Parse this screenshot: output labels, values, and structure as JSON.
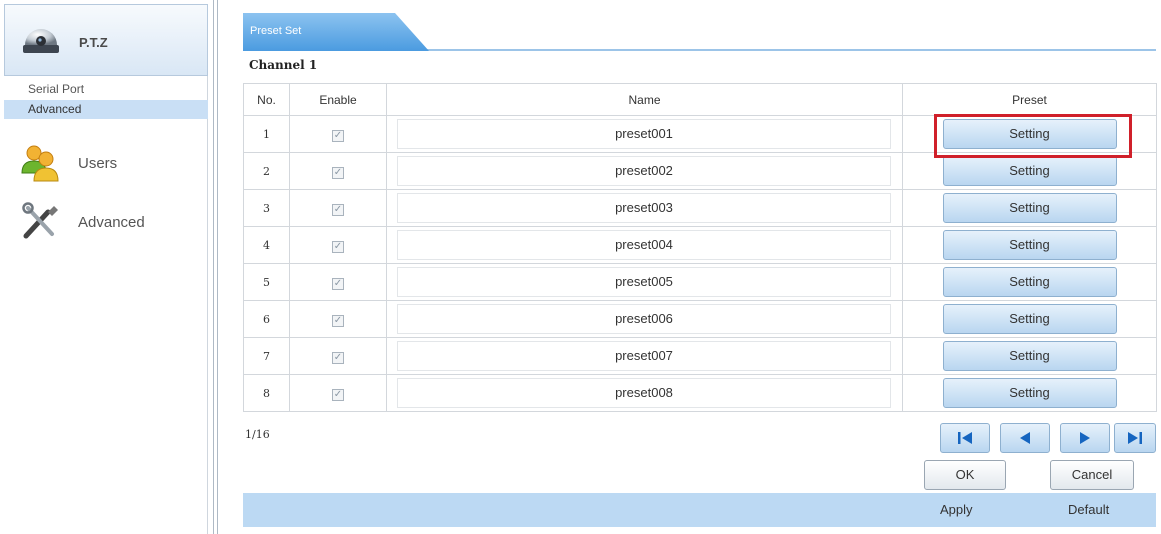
{
  "sidebar": {
    "header_label": "P.T.Z",
    "sub_items": [
      {
        "label": "Serial Port"
      },
      {
        "label": "Advanced",
        "selected": true
      }
    ],
    "menu": [
      {
        "label": "Users",
        "icon": "users-icon"
      },
      {
        "label": "Advanced",
        "icon": "tools-icon"
      }
    ]
  },
  "tab": {
    "label": "Preset Set"
  },
  "channel_title": "Channel 1",
  "table": {
    "headers": {
      "no": "No.",
      "enable": "Enable",
      "name": "Name",
      "preset": "Preset"
    },
    "rows": [
      {
        "no": "1",
        "enabled": true,
        "name": "preset001",
        "button": "Setting",
        "highlighted": true
      },
      {
        "no": "2",
        "enabled": true,
        "name": "preset002",
        "button": "Setting"
      },
      {
        "no": "3",
        "enabled": true,
        "name": "preset003",
        "button": "Setting"
      },
      {
        "no": "4",
        "enabled": true,
        "name": "preset004",
        "button": "Setting"
      },
      {
        "no": "5",
        "enabled": true,
        "name": "preset005",
        "button": "Setting"
      },
      {
        "no": "6",
        "enabled": true,
        "name": "preset006",
        "button": "Setting"
      },
      {
        "no": "7",
        "enabled": true,
        "name": "preset007",
        "button": "Setting"
      },
      {
        "no": "8",
        "enabled": true,
        "name": "preset008",
        "button": "Setting"
      }
    ]
  },
  "pagination": {
    "page_info": "1/16"
  },
  "actions": {
    "ok": "OK",
    "cancel": "Cancel",
    "apply": "Apply",
    "default": "Default"
  },
  "colors": {
    "accent": "#6aaee6",
    "highlight": "#d0202a",
    "bar": "#bcd9f3"
  }
}
